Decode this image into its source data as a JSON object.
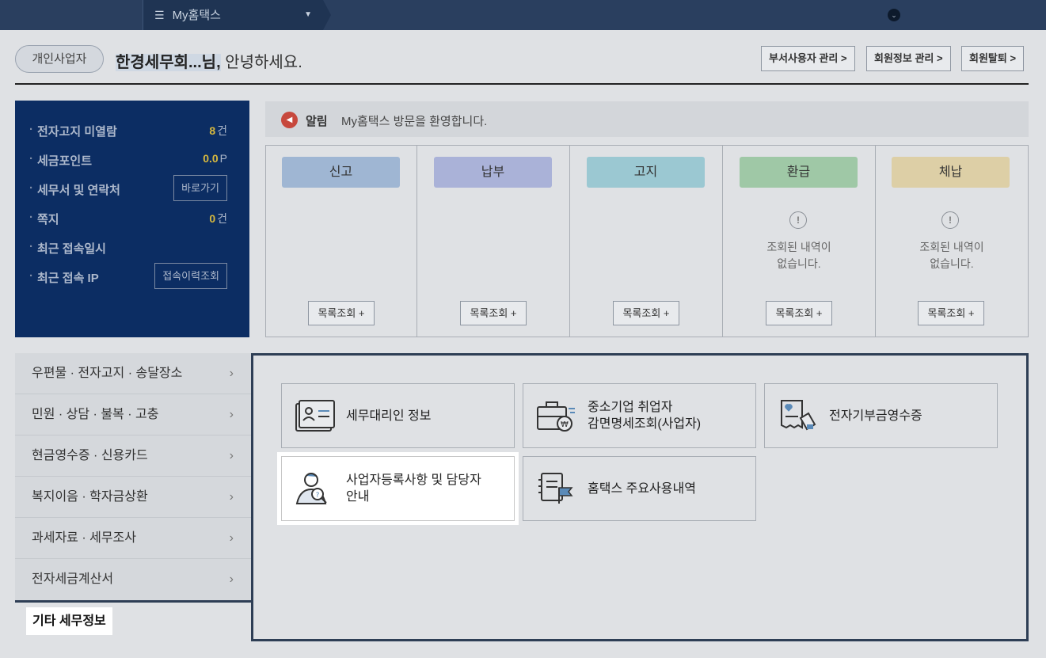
{
  "topbar": {
    "menu_label": "My홈택스",
    "menu_icon": "hamburger-icon",
    "dropdown_icon": "chevron-down-icon"
  },
  "header": {
    "user_type": "개인사업자",
    "user_name": "한경세무회...님,",
    "greeting": " 안녕하세요.",
    "buttons": [
      "부서사용자 관리 >",
      "회원정보 관리 >",
      "회원탈퇴 >"
    ]
  },
  "info": {
    "unread_label": "전자고지 미열람",
    "unread_count": "8",
    "unread_unit": "건",
    "points_label": "세금포인트",
    "points_value": "0.0",
    "points_unit": "P",
    "office_label": "세무서 및 연락처",
    "office_button": "바로가기",
    "memo_label": "쪽지",
    "memo_count": "0",
    "memo_unit": "건",
    "last_login_label": "최근 접속일시",
    "last_ip_label": "최근 접속 IP",
    "history_button": "접속이력조회"
  },
  "notice": {
    "title": "알림",
    "text": "My홈택스 방문을 환영합니다."
  },
  "status_columns": [
    {
      "title": "신고",
      "color": "#9fb6d3",
      "empty": "",
      "button": "목록조회 +"
    },
    {
      "title": "납부",
      "color": "#aab2d8",
      "empty": "",
      "button": "목록조회 +"
    },
    {
      "title": "고지",
      "color": "#9bc8d2",
      "empty": "",
      "button": "목록조회 +"
    },
    {
      "title": "환급",
      "color": "#9fc8a6",
      "empty": "조회된 내역이\n없습니다.",
      "button": "목록조회 +"
    },
    {
      "title": "체납",
      "color": "#ddcfa6",
      "empty": "조회된 내역이\n없습니다.",
      "button": "목록조회 +"
    }
  ],
  "left_menu": [
    "우편물 · 전자고지 · 송달장소",
    "민원 · 상담 · 불복 · 고충",
    "현금영수증 · 신용카드",
    "복지이음 · 학자금상환",
    "과세자료 · 세무조사",
    "전자세금계산서"
  ],
  "cards": [
    {
      "label": "세무대리인 정보",
      "icon": "tax-agent-id-card-icon"
    },
    {
      "label": "중소기업 취업자\n감면명세조회(사업자)",
      "icon": "briefcase-won-icon"
    },
    {
      "label": "전자기부금영수증",
      "icon": "donation-receipt-icon"
    },
    {
      "label": "사업자등록사항 및 담당자\n안내",
      "icon": "person-search-icon"
    },
    {
      "label": "홈택스 주요사용내역",
      "icon": "document-flag-icon"
    }
  ],
  "footer_label": "기타 세무정보"
}
